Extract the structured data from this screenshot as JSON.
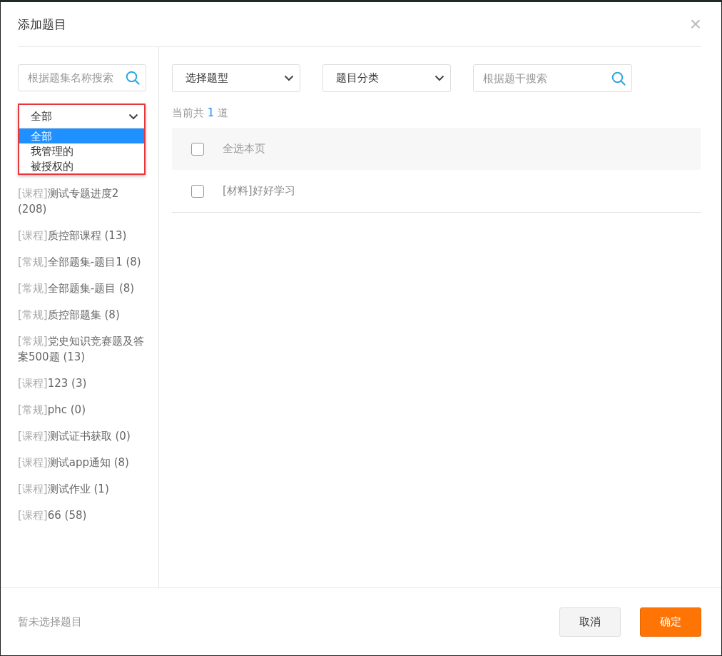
{
  "dialog": {
    "title": "添加题目",
    "close": "×"
  },
  "sidebar": {
    "search": {
      "placeholder": "根据题集名称搜索"
    },
    "filter": {
      "value": "全部",
      "expanded": true,
      "options": [
        {
          "label": "全部",
          "selected": true
        },
        {
          "label": "我管理的",
          "selected": false
        },
        {
          "label": "被授权的",
          "selected": false
        }
      ]
    },
    "items": [
      {
        "tag": "[课程]",
        "name": "测试专题进度2 (208)"
      },
      {
        "tag": "[课程]",
        "name": "质控部课程 (13)"
      },
      {
        "tag": "[常规]",
        "name": "全部题集-题目1 (8)"
      },
      {
        "tag": "[常规]",
        "name": "全部题集-题目 (8)"
      },
      {
        "tag": "[常规]",
        "name": "质控部题集 (8)"
      },
      {
        "tag": "[常规]",
        "name": "党史知识竞赛题及答案500题 (13)"
      },
      {
        "tag": "[课程]",
        "name": "123 (3)"
      },
      {
        "tag": "[常规]",
        "name": "phc (0)"
      },
      {
        "tag": "[课程]",
        "name": "测试证书获取 (0)"
      },
      {
        "tag": "[课程]",
        "name": "测试app通知 (8)"
      },
      {
        "tag": "[课程]",
        "name": "测试作业 (1)"
      },
      {
        "tag": "[课程]",
        "name": "66 (58)"
      }
    ]
  },
  "filters": {
    "type_select": "选择题型",
    "category_select": "题目分类",
    "search": {
      "placeholder": "根据题干搜索"
    }
  },
  "count": {
    "prefix": "当前共",
    "number": "1",
    "suffix": "道"
  },
  "table": {
    "header": {
      "label": "全选本页",
      "checked": false
    },
    "rows": [
      {
        "label": "[材料]好好学习",
        "checked": false
      }
    ]
  },
  "footer": {
    "status": "暂未选择题目",
    "buttons": [
      {
        "label": "取消",
        "kind": "secondary"
      },
      {
        "label": "确定",
        "kind": "primary"
      }
    ]
  }
}
